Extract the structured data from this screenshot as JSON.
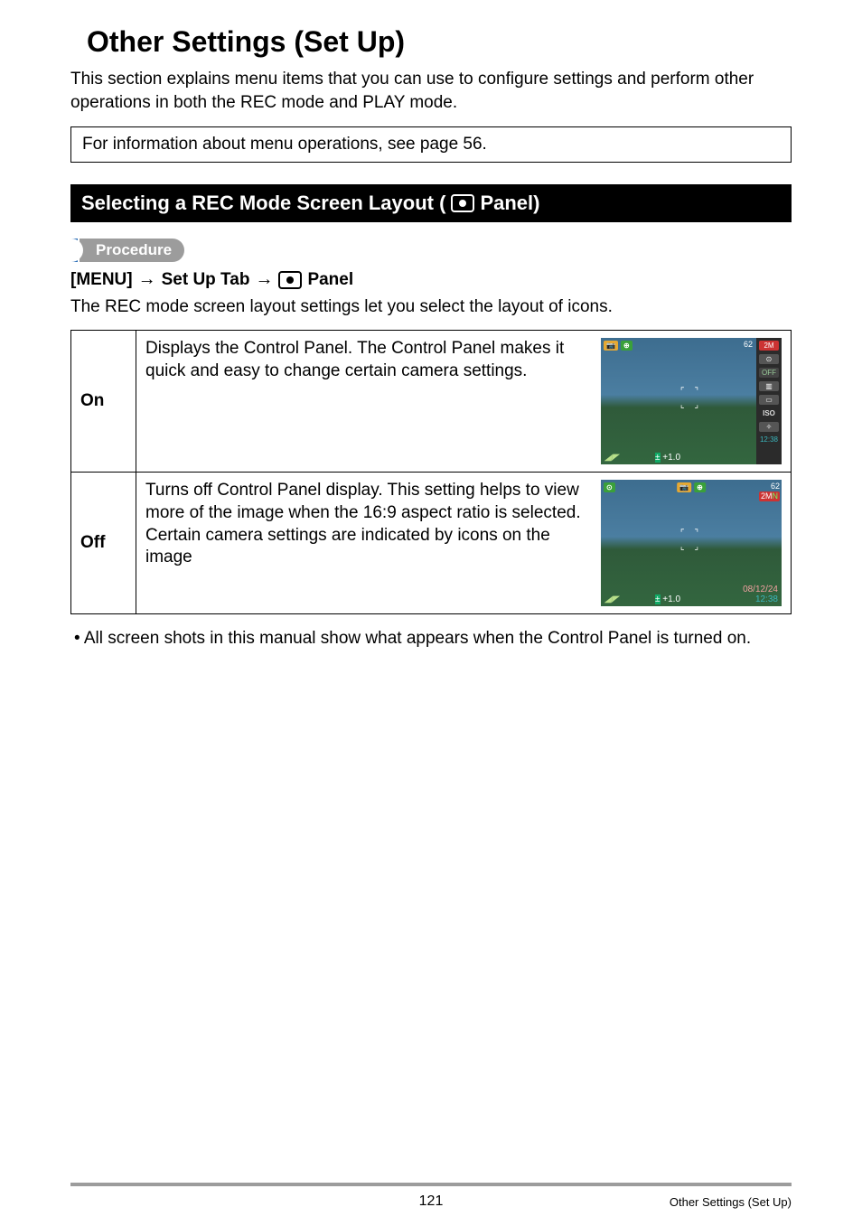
{
  "title": "Other Settings (Set Up)",
  "intro": "This section explains menu items that you can use to configure settings and perform other operations in both the REC mode and PLAY mode.",
  "note_box": "For information about menu operations, see page 56.",
  "section_bar": {
    "prefix": "Selecting a REC Mode Screen Layout (",
    "suffix": " Panel)"
  },
  "procedure_label": "Procedure",
  "procedure_line": {
    "part1": "[MENU]",
    "part2": "Set Up Tab",
    "part3": "Panel"
  },
  "layout_intro": "The REC mode screen layout settings let you select the layout of icons.",
  "options": [
    {
      "label": "On",
      "text": "Displays the Control Panel. The Control Panel makes it quick and easy to change certain camera settings.",
      "thumb": {
        "with_panel": true,
        "top_right_1": "62",
        "top_right_badge": "2M",
        "panel_off": "OFF",
        "panel_iso": "ISO",
        "panel_time": "12:38",
        "ev": "+1.0",
        "tl_icons": [
          "📷",
          "⊕"
        ]
      }
    },
    {
      "label": "Off",
      "text": "Turns off Control Panel display. This setting helps to view more of the image when the 16:9 aspect ratio is selected. Certain camera settings are indicated by icons on the image",
      "thumb": {
        "with_panel": false,
        "top_right_1": "62",
        "top_right_badge": "2M",
        "date": "08/12/24",
        "time": "12:38",
        "ev": "+1.0",
        "tl_icons": [
          "⊙",
          "📷",
          "⊕"
        ]
      }
    }
  ],
  "bullet_note": "• All screen shots in this manual show what appears when the Control Panel is turned on.",
  "footer": {
    "page": "121",
    "section": "Other Settings (Set Up)"
  }
}
